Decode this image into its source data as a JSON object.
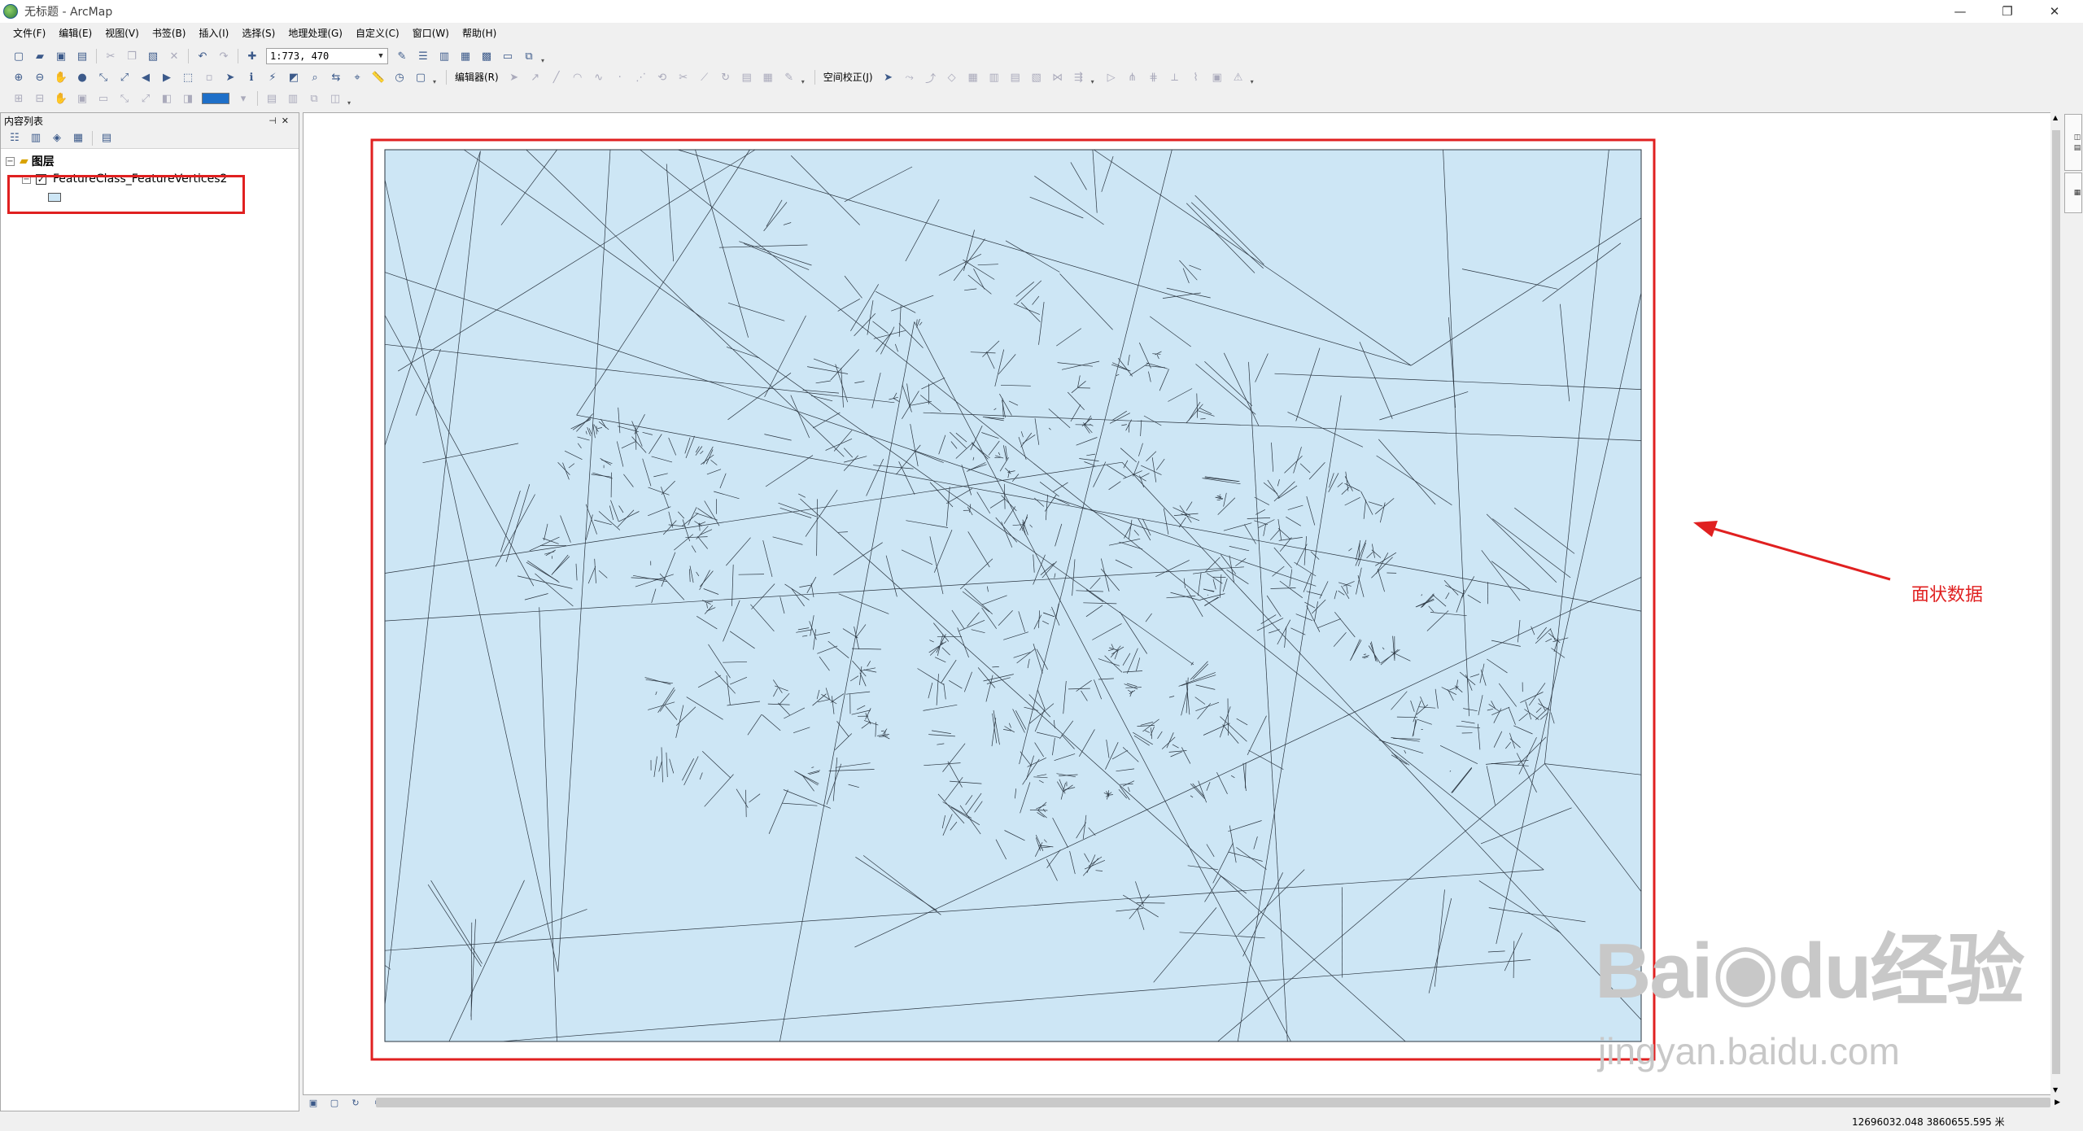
{
  "window": {
    "title": "无标题 - ArcMap"
  },
  "menu": [
    "文件(F)",
    "编辑(E)",
    "视图(V)",
    "书签(B)",
    "插入(I)",
    "选择(S)",
    "地理处理(G)",
    "自定义(C)",
    "窗口(W)",
    "帮助(H)"
  ],
  "toolbar": {
    "scale_value": "1:773, 470",
    "editor_label": "编辑器(R)",
    "spatial_adjust_label": "空间校正(J)"
  },
  "toc": {
    "title": "内容列表",
    "root_label": "图层",
    "layer_name": "FeatureClass_FeatureVertices2",
    "layer_checked": true
  },
  "status": {
    "coords": "12696032.048  3860655.595 米"
  },
  "annotation": {
    "label": "面状数据"
  },
  "watermark": {
    "text": "Baidu经验",
    "url": "jingyan.baidu.com"
  },
  "colors": {
    "polygon_fill": "#cde6f5",
    "highlight": "#e02020",
    "edge": "#2a3540"
  }
}
